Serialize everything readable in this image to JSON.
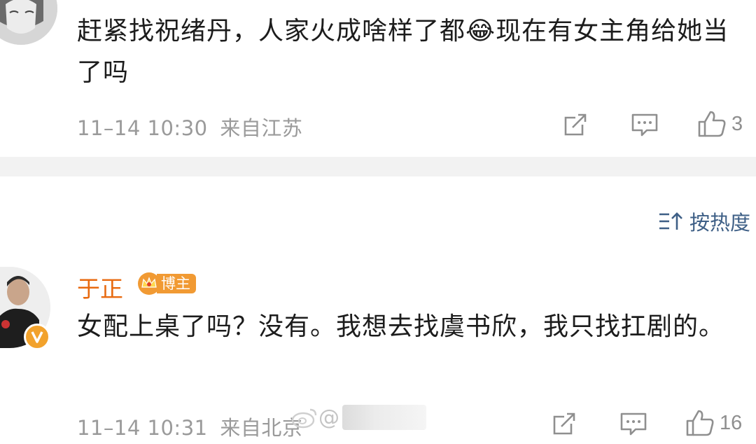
{
  "comments": [
    {
      "text": "赶紧找祝绪丹，人家火成啥样了都😂现在有女主角给她当了吗",
      "time": "11–14 10:30",
      "location": "来自江苏",
      "like_count": "3"
    },
    {
      "username": "于正",
      "badge": "博主",
      "text": "女配上桌了吗？没有。我想去找虞书欣，我只找扛剧的。",
      "time": "11–14 10:31",
      "location": "来自北京",
      "like_count": "16"
    }
  ],
  "sort_label": "按热度",
  "watermark": "@",
  "colors": {
    "username": "#e86a10",
    "sort": "#3e5f86",
    "meta": "#9a9a9a",
    "badge": "#f19a33"
  },
  "icons": [
    "repost-icon",
    "comment-icon",
    "like-icon",
    "sort-icon",
    "crown-icon",
    "verified-icon",
    "emoji-laugh-cry-icon"
  ]
}
